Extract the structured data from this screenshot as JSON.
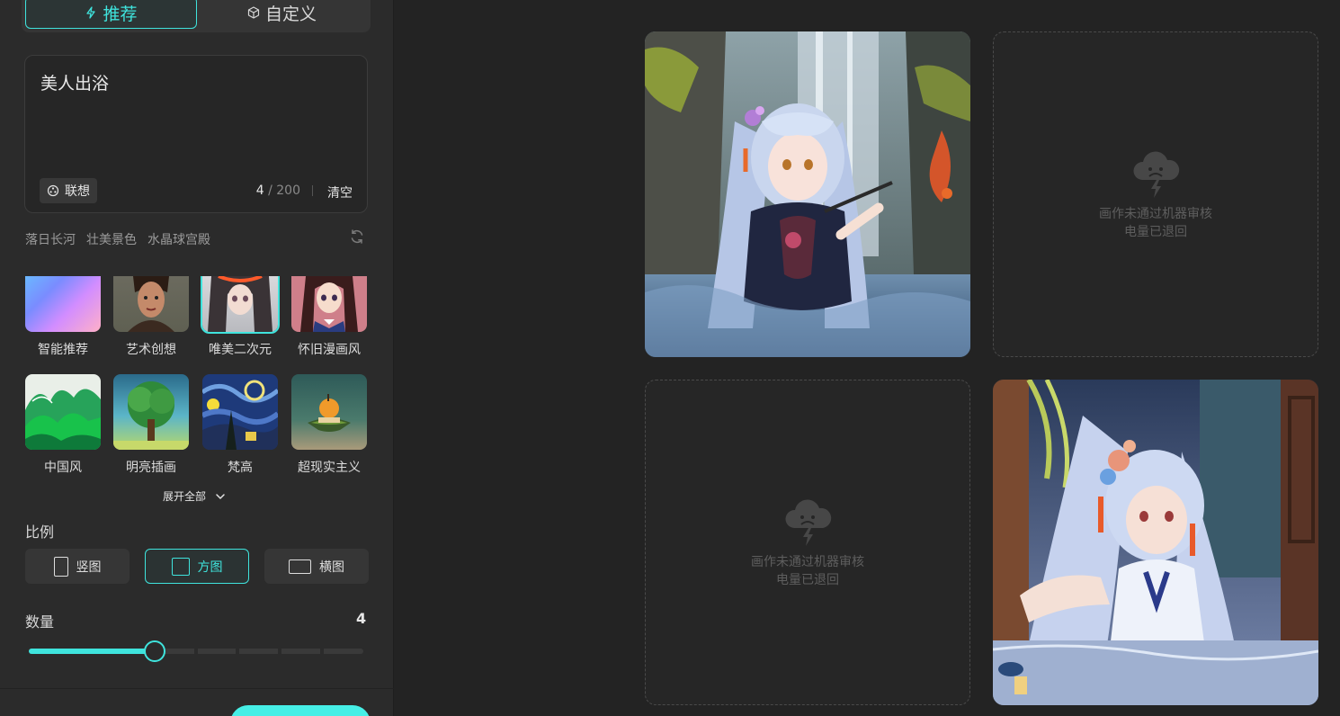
{
  "mode_tabs": [
    {
      "label": "推荐",
      "icon": "lightning-icon",
      "active": true
    },
    {
      "label": "自定义",
      "icon": "cube-icon",
      "active": false
    }
  ],
  "prompt": {
    "text": "美人出浴",
    "assoc_label": "联想",
    "count_current": "4",
    "count_sep": " / ",
    "count_max": "200",
    "clear_label": "清空"
  },
  "suggestions": [
    "落日长河",
    "壮美景色",
    "水晶球宫殿"
  ],
  "styles": [
    {
      "label": "智能推荐",
      "selected": false
    },
    {
      "label": "艺术创想",
      "selected": false
    },
    {
      "label": "唯美二次元",
      "selected": true
    },
    {
      "label": "怀旧漫画风",
      "selected": false
    },
    {
      "label": "中国风",
      "selected": false
    },
    {
      "label": "明亮插画",
      "selected": false
    },
    {
      "label": "梵高",
      "selected": false
    },
    {
      "label": "超现实主义",
      "selected": false
    }
  ],
  "expand_label": "展开全部",
  "ratio": {
    "label": "比例",
    "options": [
      {
        "label": "竖图",
        "active": false
      },
      {
        "label": "方图",
        "active": true
      },
      {
        "label": "横图",
        "active": false
      }
    ]
  },
  "quantity": {
    "label": "数量",
    "value": "4",
    "level": 0.375
  },
  "results": [
    {
      "status": "image"
    },
    {
      "status": "failed",
      "line1": "画作未通过机器审核",
      "line2": "电量已退回"
    },
    {
      "status": "failed",
      "line1": "画作未通过机器审核",
      "line2": "电量已退回"
    },
    {
      "status": "image"
    }
  ],
  "colors": {
    "accent": "#3fe4dd",
    "panel": "#2b2b2b",
    "background": "#232323"
  }
}
